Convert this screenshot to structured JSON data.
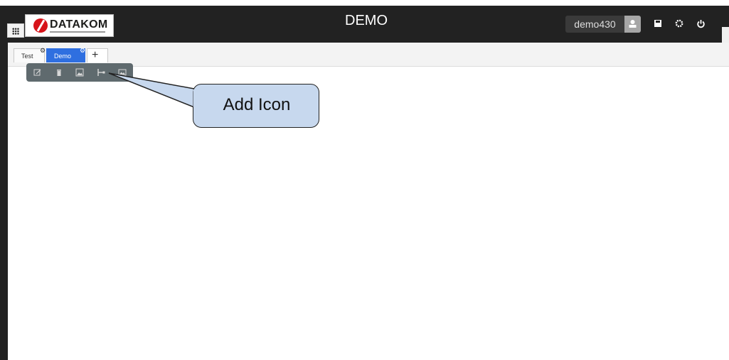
{
  "header": {
    "title": "DEMO",
    "brand": "DATAKOM",
    "brand_color": "#d7141a",
    "username": "demo430",
    "icons": [
      "user-icon",
      "save-icon",
      "settings-icon",
      "power-icon"
    ]
  },
  "tabs": [
    {
      "label": "Test",
      "active": false
    },
    {
      "label": "Demo",
      "active": true
    },
    {
      "label": "+",
      "active": false
    }
  ],
  "toolbar": {
    "icons": [
      "edit-icon",
      "delete-icon",
      "add-image-icon",
      "add-icon-icon",
      "background-image-icon"
    ]
  },
  "callout": {
    "text": "Add Icon"
  },
  "colors": {
    "topbar": "#222222",
    "active_tab": "#2f6fe0",
    "toolbar": "#5f6a6e",
    "callout_fill": "#c7d8ee"
  }
}
